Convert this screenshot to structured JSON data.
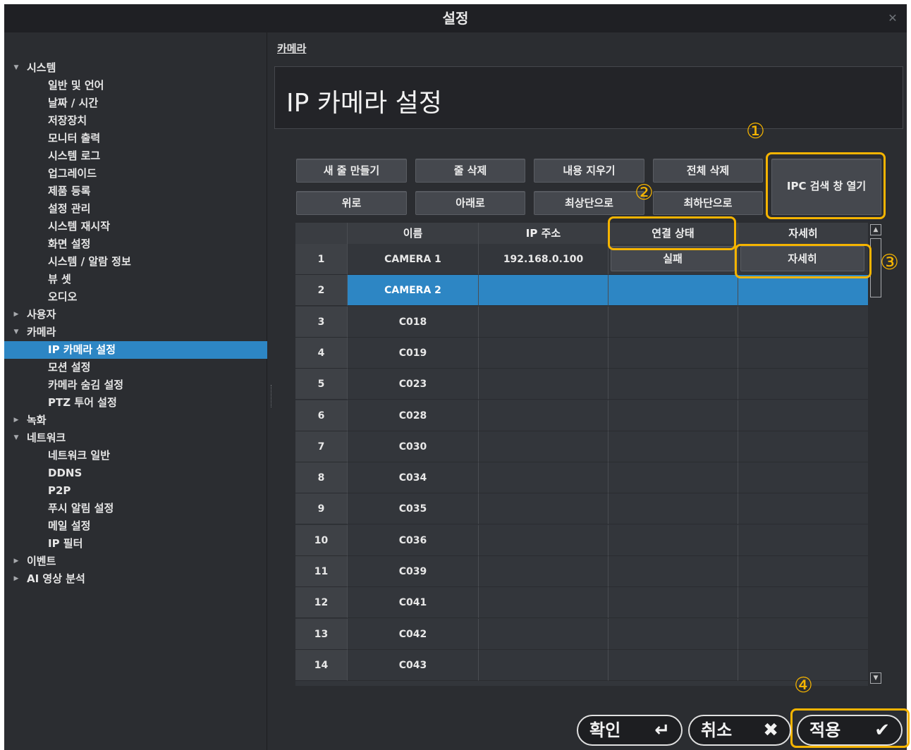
{
  "window": {
    "title": "설정",
    "close_icon": "close-icon"
  },
  "sidebar": {
    "items": [
      {
        "label": "시스템",
        "level": 0,
        "arrow": "expanded"
      },
      {
        "label": "일반 및 언어",
        "level": 1
      },
      {
        "label": "날짜 / 시간",
        "level": 1
      },
      {
        "label": "저장장치",
        "level": 1
      },
      {
        "label": "모니터 출력",
        "level": 1
      },
      {
        "label": "시스템 로그",
        "level": 1
      },
      {
        "label": "업그레이드",
        "level": 1
      },
      {
        "label": "제품 등록",
        "level": 1
      },
      {
        "label": "설정 관리",
        "level": 1
      },
      {
        "label": "시스템 재시작",
        "level": 1
      },
      {
        "label": "화면 설정",
        "level": 1
      },
      {
        "label": "시스템 / 알람 정보",
        "level": 1
      },
      {
        "label": "뷰 셋",
        "level": 1
      },
      {
        "label": "오디오",
        "level": 1
      },
      {
        "label": "사용자",
        "level": 0,
        "arrow": "collapsed"
      },
      {
        "label": "카메라",
        "level": 0,
        "arrow": "expanded"
      },
      {
        "label": "IP 카메라 설정",
        "level": 1,
        "selected": true
      },
      {
        "label": "모션 설정",
        "level": 1
      },
      {
        "label": "카메라 숨김 설정",
        "level": 1
      },
      {
        "label": "PTZ 투어 설정",
        "level": 1
      },
      {
        "label": "녹화",
        "level": 0,
        "arrow": "collapsed"
      },
      {
        "label": "네트워크",
        "level": 0,
        "arrow": "expanded"
      },
      {
        "label": "네트워크 일반",
        "level": 1
      },
      {
        "label": "DDNS",
        "level": 1
      },
      {
        "label": "P2P",
        "level": 1
      },
      {
        "label": "푸시 알림 설정",
        "level": 1
      },
      {
        "label": "메일 설정",
        "level": 1
      },
      {
        "label": "IP 필터",
        "level": 1
      },
      {
        "label": "이벤트",
        "level": 0,
        "arrow": "collapsed"
      },
      {
        "label": "AI 영상 분석",
        "level": 0,
        "arrow": "collapsed"
      }
    ]
  },
  "main": {
    "breadcrumb": "카메라",
    "title": "IP 카메라 설정",
    "toolbar": {
      "new_row": "새 줄 만들기",
      "delete_row": "줄 삭제",
      "clear_content": "내용 지우기",
      "delete_all": "전체 삭제",
      "up": "위로",
      "down": "아래로",
      "to_top": "최상단으로",
      "to_bottom": "최하단으로",
      "ipc_search": "IPC 검색 창 열기"
    },
    "table": {
      "headers": [
        "이름",
        "IP 주소",
        "연결 상태",
        "자세히"
      ],
      "rows": [
        {
          "idx": "1",
          "name": "CAMERA 1",
          "ip": "192.168.0.100",
          "status": "실패",
          "detail": "자세히"
        },
        {
          "idx": "2",
          "name": "CAMERA 2",
          "ip": "",
          "status": "",
          "detail": "",
          "selected": true
        },
        {
          "idx": "3",
          "name": "C018"
        },
        {
          "idx": "4",
          "name": "C019"
        },
        {
          "idx": "5",
          "name": "C023"
        },
        {
          "idx": "6",
          "name": "C028"
        },
        {
          "idx": "7",
          "name": "C030"
        },
        {
          "idx": "8",
          "name": "C034"
        },
        {
          "idx": "9",
          "name": "C035"
        },
        {
          "idx": "10",
          "name": "C036"
        },
        {
          "idx": "11",
          "name": "C039"
        },
        {
          "idx": "12",
          "name": "C041"
        },
        {
          "idx": "13",
          "name": "C042"
        },
        {
          "idx": "14",
          "name": "C043"
        }
      ]
    },
    "annotations": [
      "①",
      "②",
      "③",
      "④"
    ],
    "accent_color": "#f5b400",
    "selection_color": "#2d86c4"
  },
  "footer": {
    "ok": "확인",
    "cancel": "취소",
    "apply": "적용",
    "ok_icon": "enter-icon",
    "cancel_icon": "x-icon",
    "apply_icon": "check-icon"
  }
}
